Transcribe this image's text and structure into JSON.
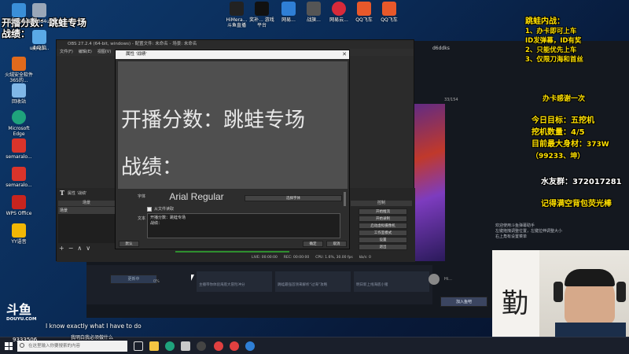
{
  "desktop_icons": [
    {
      "label": "新建文件夹"
    },
    {
      "label": "ISwe0d4u1"
    },
    {
      "label": "此电脑"
    },
    {
      "label": "u4421..."
    },
    {
      "label": "火绒安全软件 365的..."
    },
    {
      "label": "回收站"
    },
    {
      "label": "Microsoft Edge"
    },
    {
      "label": "semaralo..."
    },
    {
      "label": "semaralo..."
    },
    {
      "label": "WPS Office"
    },
    {
      "label": "YY语音"
    }
  ],
  "top_icons": [
    {
      "label": "HiMera...\n斗鱼直播"
    },
    {
      "label": "奖补...\n游戏平台"
    },
    {
      "label": "网易..."
    },
    {
      "label": "战旗..."
    },
    {
      "label": "网易云..."
    },
    {
      "label": "QQ飞车"
    },
    {
      "label": "QQ飞车"
    }
  ],
  "overlay_topleft": {
    "line1": "开播分数：跳蛙专场",
    "line2": "战绩："
  },
  "overlay_right": {
    "title": "跳蛙内战：",
    "rules": [
      "1、办卡即可上车",
      "ID发弹幕，ID有奖",
      "2、只能优先上车",
      "3、仅限刀海和首丝"
    ],
    "thanks": "办卡感谢一次",
    "goal": "今日目标：五挖机",
    "count": "挖机数量：4/5",
    "record_label": "目前最大身材：",
    "record_value": "373W",
    "record_sub": "（99233、坤）",
    "qq_group": "水友群：372017281",
    "reminder": "记得满空背包荧光棒"
  },
  "obs": {
    "title": "OBS 27.2.4 (64-bit, windows) - 配置文件: 未命名 - 场景: 未命名",
    "menu": [
      "文件(F)",
      "编辑(E)",
      "视图(V)"
    ],
    "panels": {
      "scenes": "场景",
      "sources": "来源",
      "controls": "控制"
    },
    "scene_item": "场景",
    "source_label": "文本",
    "controls": [
      "开始推流",
      "开始录制",
      "启动虚拟摄像机",
      "工作室模式",
      "设置",
      "退出"
    ],
    "status": {
      "live": "LIVE: 00:00:00",
      "rec": "REC: 00:00:00",
      "cpu": "CPU: 1.6%, 30.00 fps",
      "kbs": "kb/s: 0"
    }
  },
  "props_dialog": {
    "title": "属性 '战绩'",
    "preview_line1": "开播分数：跳蛙专场",
    "preview_line2": "战绩：",
    "font_label": "字体",
    "font_value": "Arial Regular",
    "font_button": "选择字体",
    "file_checkbox": "从文件读取",
    "text_label": "文本",
    "text_value": "开播分数：跳蛙专场\n战绩：",
    "defaults_button": "默认",
    "ok_button": "确定",
    "cancel_button": "取消"
  },
  "stream": {
    "streamer_name": "d6ddks",
    "rank_number": "33/154",
    "bottom_button": "更新中",
    "cards": [
      "主播带你体验海底大冒险冲分",
      "跳蛙最强首领来解析“过海”攻略",
      "明日新上线海底小猪"
    ],
    "follow_button": "加入鱼吧",
    "chat": [
      "欢迎使用斗鱼弹幕助手",
      "左键拖拽调整位置，左键拉伸调整大小",
      "右上角有设置菜单"
    ],
    "viewer_badge": "Hi...",
    "progress": "0%"
  },
  "douyu": {
    "logo": "斗鱼",
    "domain": "DOUYU.COM",
    "room": "9333506"
  },
  "subtitles": {
    "english": "I know exactly what I have to do",
    "chinese": "我明白我必须做什么"
  },
  "taskbar": {
    "search_placeholder": "在这里输入你要搜索的内容"
  },
  "calligraphy": "勤"
}
